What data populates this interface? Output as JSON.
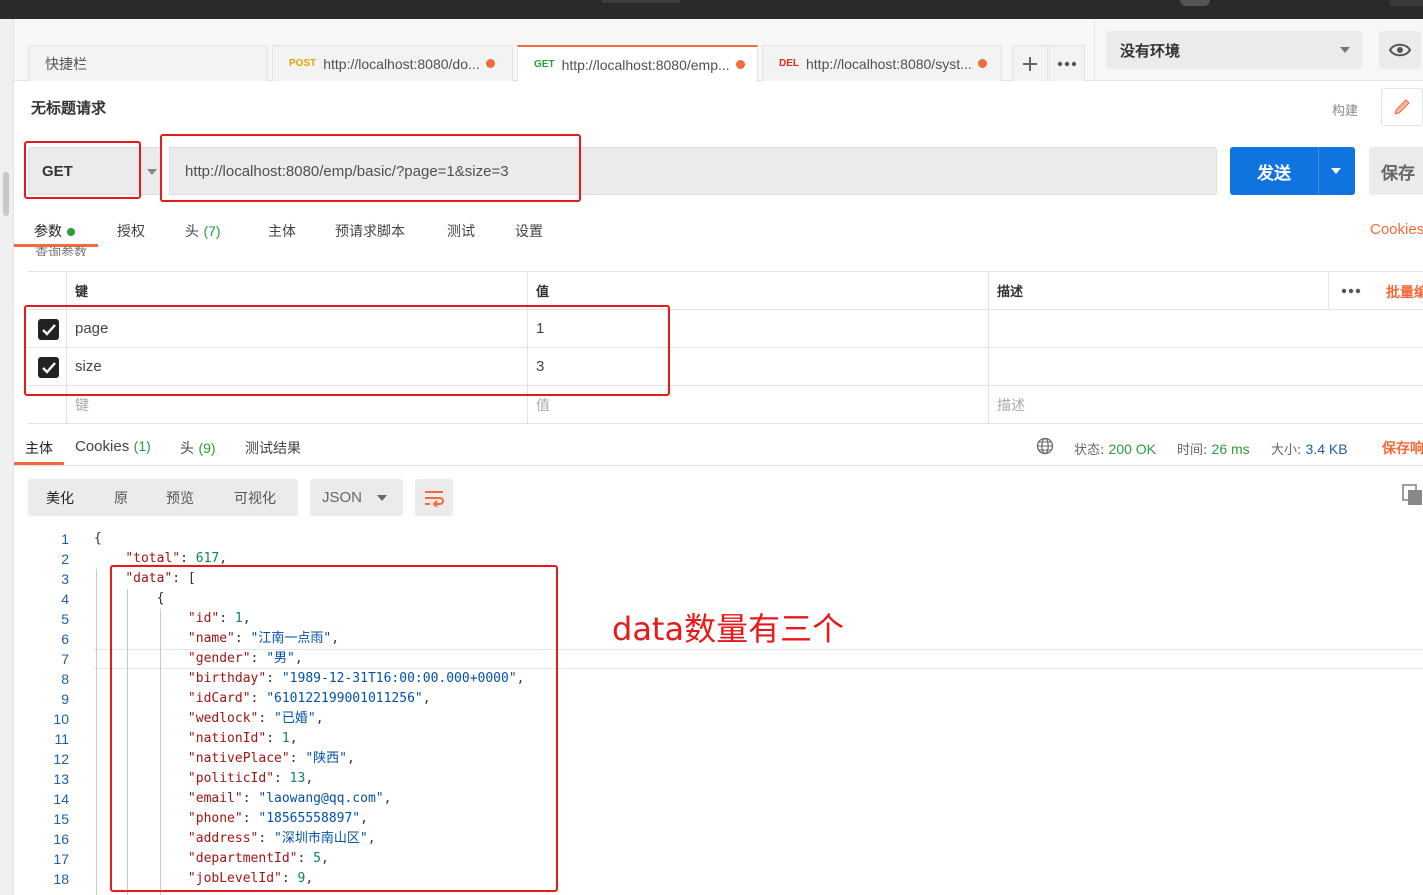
{
  "tabs": {
    "quickbar": "快捷栏",
    "items": [
      {
        "method": "POST",
        "method_color": "#e5a300",
        "url": "http://localhost:8080/do..."
      },
      {
        "method": "GET",
        "method_color": "#2a9d3a",
        "url": "http://localhost:8080/emp..."
      },
      {
        "method": "DEL",
        "method_color": "#d9301c",
        "url": "http://localhost:8080/syst..."
      }
    ],
    "new_tab_icon": "plus-icon",
    "more_icon": "ellipsis-icon"
  },
  "environment": {
    "selected": "没有环境"
  },
  "request": {
    "title": "无标题请求",
    "build_label": "构建",
    "method": "GET",
    "url": "http://localhost:8080/emp/basic/?page=1&size=3",
    "send_label": "发送",
    "save_label": "保存"
  },
  "request_tabs": {
    "params": "参数",
    "auth": "授权",
    "headers": "头",
    "headers_count": "(7)",
    "body": "主体",
    "pre_request": "预请求脚本",
    "tests": "测试",
    "settings": "设置",
    "cookies": "Cookies",
    "query_params_label": "查询参数"
  },
  "params_table": {
    "col_key": "键",
    "col_value": "值",
    "col_desc": "描述",
    "bulk_edit": "批量编",
    "rows": [
      {
        "key": "page",
        "value": "1",
        "checked": true
      },
      {
        "key": "size",
        "value": "3",
        "checked": true
      }
    ],
    "placeholder_key": "键",
    "placeholder_value": "值",
    "placeholder_desc": "描述"
  },
  "response_tabs": {
    "body": "主体",
    "cookies": "Cookies",
    "cookies_count": "(1)",
    "headers": "头",
    "headers_count": "(9)",
    "test_results": "测试结果",
    "status_label": "状态:",
    "status_value": "200 OK",
    "time_label": "时间:",
    "time_value": "26 ms",
    "size_label": "大小:",
    "size_value": "3.4 KB",
    "save_response": "保存响"
  },
  "format_bar": {
    "pretty": "美化",
    "raw": "原",
    "preview": "预览",
    "visualize": "可视化",
    "format": "JSON"
  },
  "code_lines": [
    {
      "n": "1",
      "html": "<span class=\"p\">{</span>"
    },
    {
      "n": "2",
      "html": "    <span class=\"k\">\"total\"</span><span class=\"p\">: </span><span class=\"n\">617</span><span class=\"p\">,</span>"
    },
    {
      "n": "3",
      "html": "    <span class=\"k\">\"data\"</span><span class=\"p\">: [</span>"
    },
    {
      "n": "4",
      "html": "        <span class=\"p\">{</span>"
    },
    {
      "n": "5",
      "html": "            <span class=\"k\">\"id\"</span><span class=\"p\">: </span><span class=\"n\">1</span><span class=\"p\">,</span>"
    },
    {
      "n": "6",
      "html": "            <span class=\"k\">\"name\"</span><span class=\"p\">: </span><span class=\"s\">\"江南一点雨\"</span><span class=\"p\">,</span>"
    },
    {
      "n": "7",
      "html": "            <span class=\"k\">\"gender\"</span><span class=\"p\">: </span><span class=\"s\">\"男\"</span><span class=\"p\">,</span>"
    },
    {
      "n": "8",
      "html": "            <span class=\"k\">\"birthday\"</span><span class=\"p\">: </span><span class=\"s\">\"1989-12-31T16:00:00.000+0000\"</span><span class=\"p\">,</span>"
    },
    {
      "n": "9",
      "html": "            <span class=\"k\">\"idCard\"</span><span class=\"p\">: </span><span class=\"s\">\"610122199001011256\"</span><span class=\"p\">,</span>"
    },
    {
      "n": "10",
      "html": "            <span class=\"k\">\"wedlock\"</span><span class=\"p\">: </span><span class=\"s\">\"已婚\"</span><span class=\"p\">,</span>"
    },
    {
      "n": "11",
      "html": "            <span class=\"k\">\"nationId\"</span><span class=\"p\">: </span><span class=\"n\">1</span><span class=\"p\">,</span>"
    },
    {
      "n": "12",
      "html": "            <span class=\"k\">\"nativePlace\"</span><span class=\"p\">: </span><span class=\"s\">\"陕西\"</span><span class=\"p\">,</span>"
    },
    {
      "n": "13",
      "html": "            <span class=\"k\">\"politicId\"</span><span class=\"p\">: </span><span class=\"n\">13</span><span class=\"p\">,</span>"
    },
    {
      "n": "14",
      "html": "            <span class=\"k\">\"email\"</span><span class=\"p\">: </span><span class=\"s\">\"laowang@qq.com\"</span><span class=\"p\">,</span>"
    },
    {
      "n": "15",
      "html": "            <span class=\"k\">\"phone\"</span><span class=\"p\">: </span><span class=\"s\">\"18565558897\"</span><span class=\"p\">,</span>"
    },
    {
      "n": "16",
      "html": "            <span class=\"k\">\"address\"</span><span class=\"p\">: </span><span class=\"s\">\"深圳市南山区\"</span><span class=\"p\">,</span>"
    },
    {
      "n": "17",
      "html": "            <span class=\"k\">\"departmentId\"</span><span class=\"p\">: </span><span class=\"n\">5</span><span class=\"p\">,</span>"
    },
    {
      "n": "18",
      "html": "            <span class=\"k\">\"jobLevelId\"</span><span class=\"p\">: </span><span class=\"n\">9</span><span class=\"p\">,</span>"
    }
  ],
  "annotation": {
    "text": "data数量有三个",
    "color": "#e8191b"
  },
  "colors": {
    "accent": "#f26b3a",
    "send_button": "#0f74e0",
    "success": "#2a9d3a"
  }
}
